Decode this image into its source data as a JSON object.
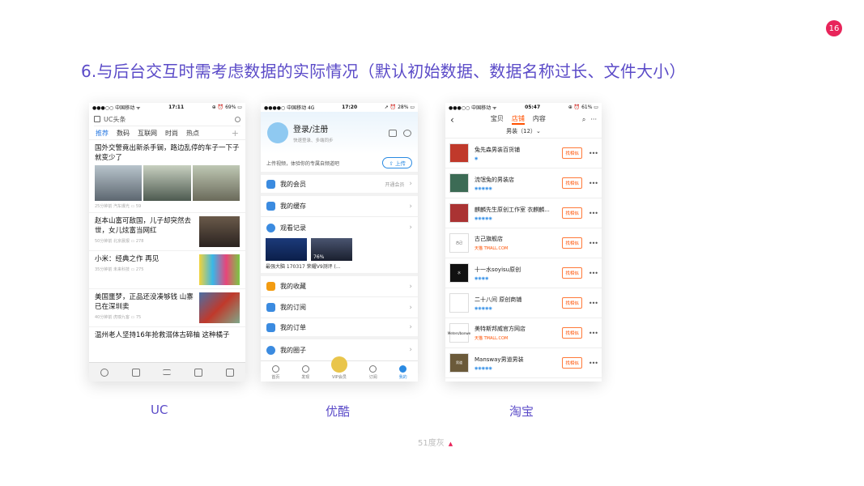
{
  "slide_number": "16",
  "heading": "6.与后台交互时需考虑数据的实际情况（默认初始数据、数据名称过长、文件大小）",
  "captions": [
    "UC",
    "优酷",
    "淘宝"
  ],
  "footer": "51度灰",
  "colors": {
    "accent": "#5b4bc8",
    "badge": "#e8245a",
    "youku_blue": "#2a8ae2",
    "taobao_orange": "#ff5000"
  },
  "uc": {
    "status": {
      "left": "●●●○○ 中国移动 ᯤ",
      "time": "17:11",
      "right": "⊕ ⏰ 69% ▭"
    },
    "search_label": "UC头条",
    "tabs": [
      "推荐",
      "数码",
      "互联网",
      "时尚",
      "热点"
    ],
    "news": [
      {
        "title": "国外交警竟出新杀手锏，路边乱停的车子一下子就变少了",
        "meta": "25分钟前 汽车爆光 ▭ 59"
      },
      {
        "title": "赵本山富可敌国，儿子却突然去世，女儿炫富当网红",
        "meta": "50分钟前 北京晨报 ▭ 278"
      },
      {
        "title": "小米：经典之作 再见",
        "meta": "35分钟前 未来科技 ▭ 275"
      },
      {
        "title": "美国噩梦，正品还没凑够钱 山寨已在深圳卖",
        "meta": "40分钟前 虎嗅九客 ▭ 75"
      },
      {
        "title": "温州老人坚持16年抢救溺体古碲柚 这种橘子",
        "meta": ""
      }
    ]
  },
  "youku": {
    "status": {
      "left": "●●●●○ 中国移动 4G",
      "time": "17:20",
      "right": "➚ ⏰ 28% ▭"
    },
    "login": "登录/注册",
    "login_sub": "快速登录、多端同步",
    "upload_text": "上传视频，体验你的专属自频道吧",
    "upload_btn": "上传",
    "menu": [
      {
        "label": "我的会员",
        "right": "开通会员"
      },
      {
        "label": "我的缓存",
        "right": ""
      },
      {
        "label": "观看记录",
        "right": ""
      }
    ],
    "video_progress": "76%",
    "video_caption": "最强大脑 170317  荣耀V9测评 (...",
    "menu2": [
      "我的收藏",
      "我的订阅",
      "我的订单"
    ],
    "menu3": "我的圈子",
    "tabbar": [
      "首页",
      "发现",
      "VIP会员",
      "订阅",
      "我的"
    ]
  },
  "taobao": {
    "status": {
      "left": "●●●○○ 中国移动 ᯤ",
      "time": "05:47",
      "right": "⊕ ⏰ 61% ▭"
    },
    "tabs": [
      "宝贝",
      "店铺",
      "内容"
    ],
    "filter": "男装（12）⌄",
    "find_similar": "找相似",
    "shops": [
      {
        "name": "兔先森男装百货铺",
        "level": "◉",
        "tmall": false,
        "logo_text": "",
        "logo_color": "#c0392b"
      },
      {
        "name": "流氓兔的男装店",
        "level": "◉◉◉◉◉",
        "tmall": false,
        "logo_text": "",
        "logo_color": "#3c6b55"
      },
      {
        "name": "麒麟先生原创工作室 衣麒麟...",
        "level": "◉◉◉◉◉",
        "tmall": false,
        "logo_text": "",
        "logo_color": "#a33"
      },
      {
        "name": "古己旗舰店",
        "level": "天猫 TMALL.COM",
        "tmall": true,
        "logo_text": "古己",
        "logo_color": "#fff"
      },
      {
        "name": "十一水soyisu原创",
        "level": "◉◉◉◉",
        "tmall": false,
        "logo_text": "水",
        "logo_color": "#111"
      },
      {
        "name": "二十八间 原创商铺",
        "level": "◉◉◉◉◉",
        "tmall": false,
        "logo_text": "",
        "logo_color": "#fff"
      },
      {
        "name": "美特斯邦威官方网店",
        "level": "天猫 TMALL.COM",
        "tmall": true,
        "logo_text": "Meters/bonwe",
        "logo_color": "#fff"
      },
      {
        "name": "Mansway男道男装",
        "level": "◉◉◉◉◉",
        "tmall": false,
        "logo_text": "男道",
        "logo_color": "#6b5a3a"
      }
    ]
  }
}
